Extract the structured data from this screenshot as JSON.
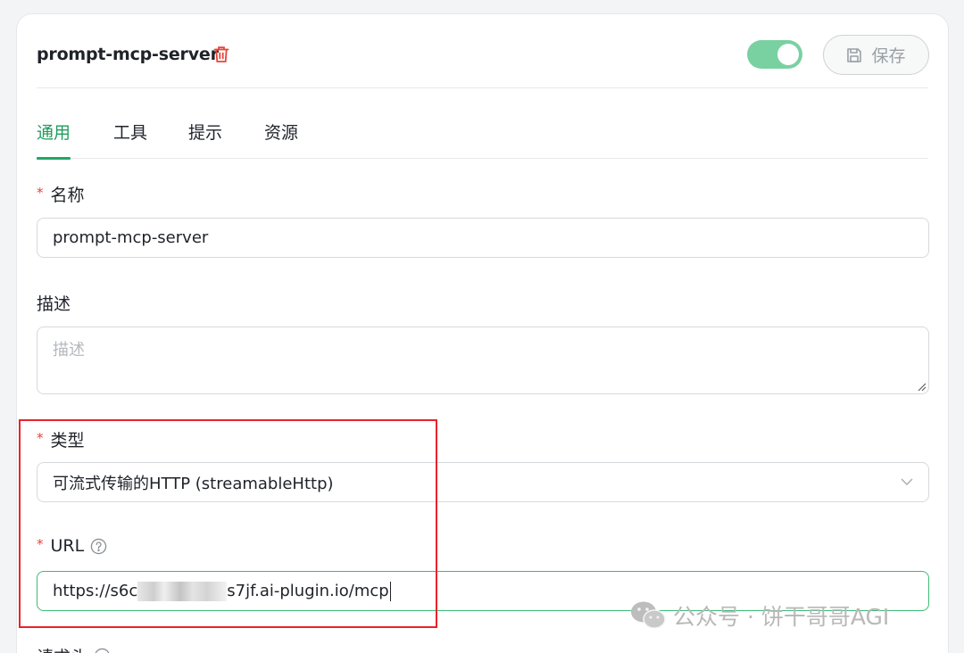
{
  "header": {
    "server_name": "prompt-mcp-server",
    "enabled": true,
    "save_label": "保存"
  },
  "tabs": [
    {
      "label": "通用",
      "active": true
    },
    {
      "label": "工具",
      "active": false
    },
    {
      "label": "提示",
      "active": false
    },
    {
      "label": "资源",
      "active": false
    }
  ],
  "form": {
    "name": {
      "label": "名称",
      "required": true,
      "value": "prompt-mcp-server"
    },
    "description": {
      "label": "描述",
      "required": false,
      "placeholder": "描述"
    },
    "type": {
      "label": "类型",
      "required": true,
      "value": "可流式传输的HTTP (streamableHttp)"
    },
    "url": {
      "label": "URL",
      "required": true,
      "value_prefix": "https://s6c",
      "value_suffix": "s7jf.ai-plugin.io/mcp"
    },
    "headers": {
      "label": "请求头"
    }
  },
  "watermark": "公众号 · 饼干哥哥AGI",
  "colors": {
    "accent": "#1f9d5c",
    "toggle_on": "#79d1a2",
    "required": "#e5453a",
    "highlight": "#e8232a"
  }
}
